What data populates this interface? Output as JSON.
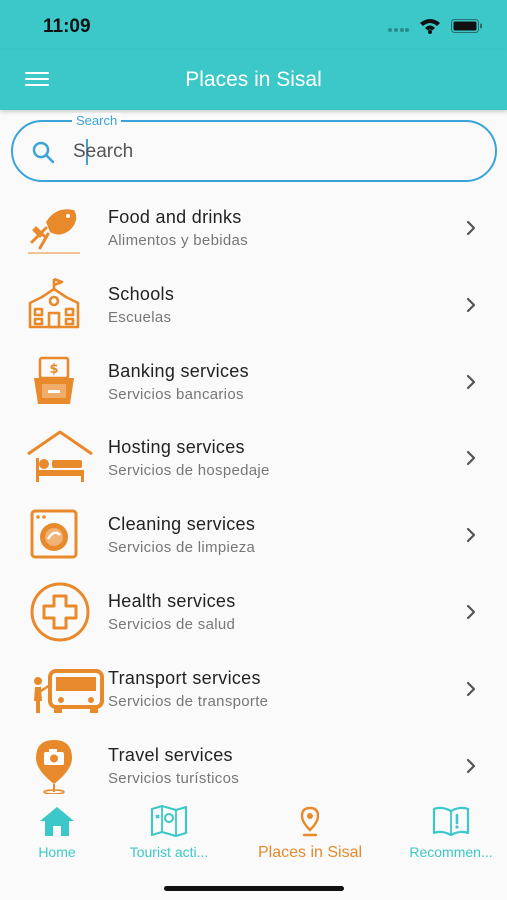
{
  "status_bar": {
    "time": "11:09"
  },
  "app_bar": {
    "title": "Places in Sisal",
    "menu_icon": "hamburger-icon"
  },
  "search": {
    "label": "Search",
    "placeholder": "Search",
    "value": ""
  },
  "categories": [
    {
      "title": "Food and drinks",
      "subtitle": "Alimentos y bebidas",
      "icon": "food-icon"
    },
    {
      "title": "Schools",
      "subtitle": "Escuelas",
      "icon": "school-icon"
    },
    {
      "title": "Banking services",
      "subtitle": "Servicios bancarios",
      "icon": "bank-icon"
    },
    {
      "title": "Hosting services",
      "subtitle": "Servicios de hospedaje",
      "icon": "bed-icon"
    },
    {
      "title": "Cleaning services",
      "subtitle": "Servicios de limpieza",
      "icon": "washing-machine-icon"
    },
    {
      "title": "Health services",
      "subtitle": "Servicios de salud",
      "icon": "health-cross-icon"
    },
    {
      "title": "Transport services",
      "subtitle": "Servicios de transporte",
      "icon": "bus-icon"
    },
    {
      "title": "Travel services",
      "subtitle": "Servicios turísticos",
      "icon": "camera-pin-icon"
    }
  ],
  "bottom_nav": [
    {
      "label": "Home",
      "icon": "home-icon",
      "active": false
    },
    {
      "label": "Tourist acti...",
      "icon": "map-icon",
      "active": false
    },
    {
      "label": "Places in Sisal",
      "icon": "location-pin-icon",
      "active": true
    },
    {
      "label": "Recommen...",
      "icon": "book-icon",
      "active": false
    }
  ],
  "colors": {
    "primary": "#3cc8c8",
    "accent": "#e8892b",
    "search_border": "#3aa3d8"
  }
}
